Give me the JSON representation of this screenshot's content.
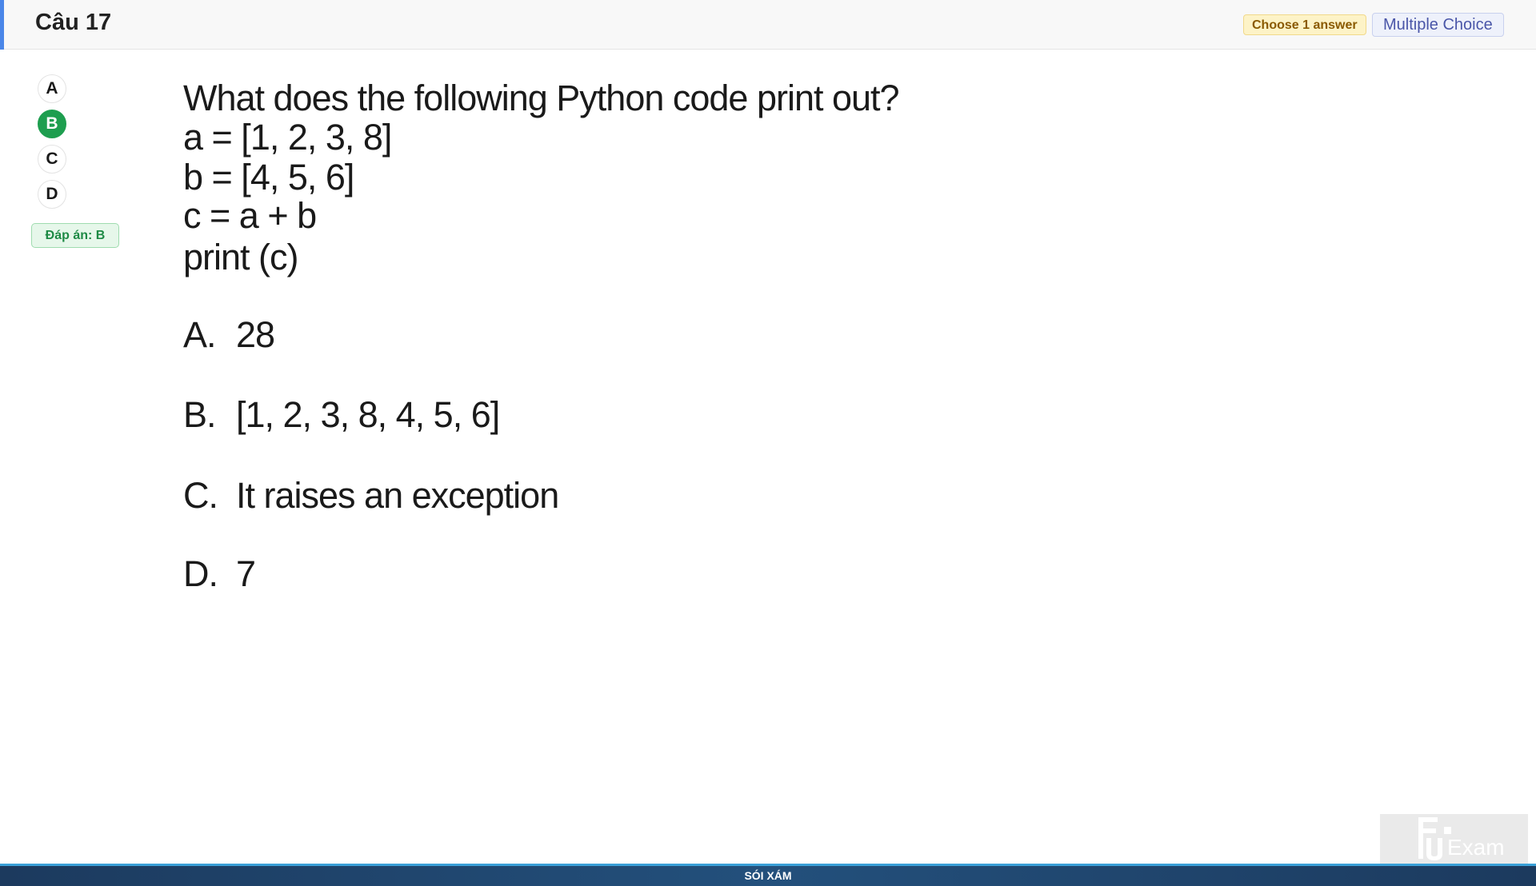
{
  "header": {
    "title": "Câu 17",
    "choose_badge": "Choose 1 answer",
    "type_badge": "Multiple Choice"
  },
  "options_nav": {
    "items": [
      {
        "label": "A",
        "selected": false
      },
      {
        "label": "B",
        "selected": true
      },
      {
        "label": "C",
        "selected": false
      },
      {
        "label": "D",
        "selected": false
      }
    ],
    "answer": "Đáp án: B"
  },
  "question": {
    "lines": [
      "What does the following Python code print out?",
      "a = [1, 2, 3, 8]",
      "b = [4, 5, 6]",
      "c = a + b",
      "print (c)"
    ],
    "choices": [
      {
        "letter": "A.",
        "text": "28"
      },
      {
        "letter": "B.",
        "text": "[1, 2, 3, 8, 4, 5, 6]"
      },
      {
        "letter": "C.",
        "text": "It raises an exception"
      },
      {
        "letter": "D.",
        "text": "7"
      }
    ]
  },
  "footer": {
    "text": "SÓI XÁM"
  },
  "logo": {
    "text": "Exam"
  },
  "colors": {
    "accent": "#4a86e8",
    "selected": "#1e9e4f"
  }
}
